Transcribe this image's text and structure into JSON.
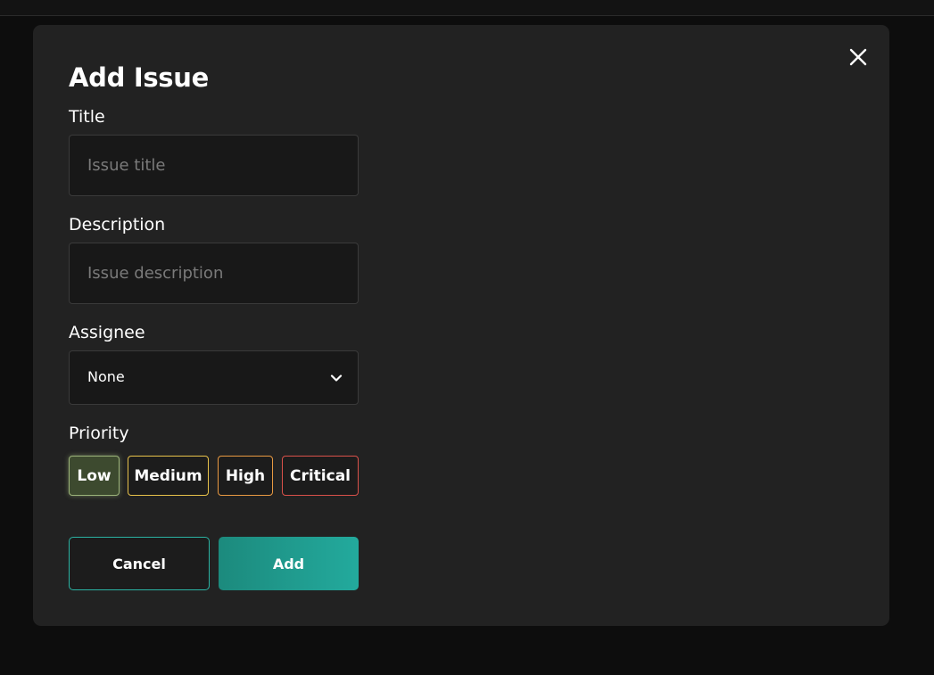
{
  "modal": {
    "title": "Add Issue",
    "close_icon": "close-icon"
  },
  "form": {
    "title_field": {
      "label": "Title",
      "placeholder": "Issue title",
      "value": ""
    },
    "description_field": {
      "label": "Description",
      "placeholder": "Issue description",
      "value": ""
    },
    "assignee_field": {
      "label": "Assignee",
      "selected": "None",
      "icon": "chevron-down-icon"
    },
    "priority": {
      "label": "Priority",
      "selected": "Low",
      "options": [
        {
          "label": "Low",
          "color": "#9cb37a"
        },
        {
          "label": "Medium",
          "color": "#e8c24a"
        },
        {
          "label": "High",
          "color": "#e99a42"
        },
        {
          "label": "Critical",
          "color": "#d9514a"
        }
      ]
    }
  },
  "actions": {
    "cancel_label": "Cancel",
    "add_label": "Add",
    "accent_color": "#23aa9d"
  }
}
